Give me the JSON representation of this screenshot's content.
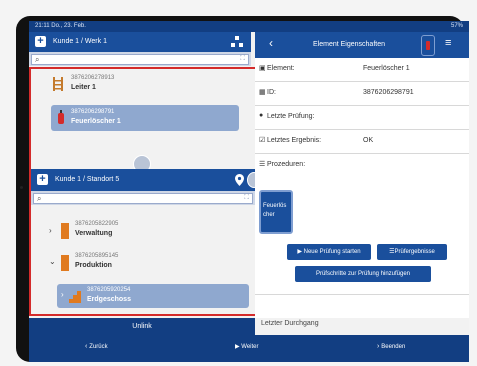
{
  "status": {
    "time": "21:11 Do., 23. Feb.",
    "battery": "57%"
  },
  "left": {
    "top_title": "Kunde 1 / Werk 1",
    "top_items": [
      {
        "code": "3876206278913",
        "name": "Leiter 1"
      },
      {
        "code": "3876206298791",
        "name": "Feuerlöscher 1"
      }
    ],
    "bottom_title": "Kunde 1 / Standort 5",
    "tree": [
      {
        "code": "3876205822905",
        "name": "Verwaltung"
      },
      {
        "code": "3876205895145",
        "name": "Produktion"
      },
      {
        "code": "3876205920254",
        "name": "Erdgeschoss"
      }
    ],
    "unlink_label": "Unlink"
  },
  "right": {
    "title": "Element Eigenschaften",
    "props": [
      {
        "key": "Element:",
        "value": "Feuerlöscher 1"
      },
      {
        "key": "ID:",
        "value": "3876206298791"
      },
      {
        "key": "Letzte Prüfung:",
        "value": ""
      },
      {
        "key": "Letztes Ergebnis:",
        "value": "OK"
      },
      {
        "key": "Prozeduren:",
        "value": ""
      }
    ],
    "procedure_tile": "Feuerlöscher",
    "btn_new_check": "Neue Prüfung starten",
    "btn_results": "Prüfergebnisse",
    "btn_add_steps": "Prüfschritte zur Prüfung hinzufügen",
    "last_run": "Letzter Durchgang"
  },
  "footer": {
    "back": "Zurück",
    "next": "Weiter",
    "end": "Beenden"
  },
  "colors": {
    "accent": "#1a4f9c",
    "highlight": "#d42b2b"
  }
}
